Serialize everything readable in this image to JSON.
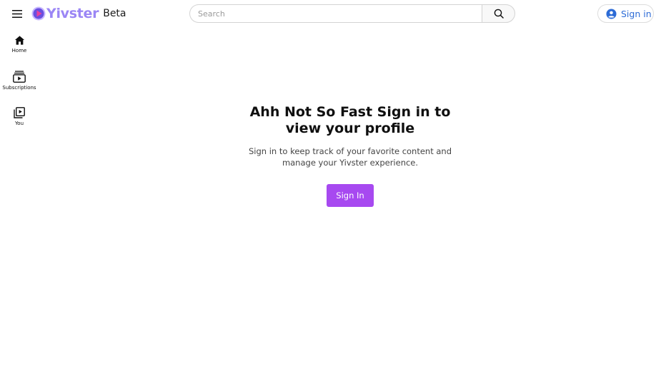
{
  "header": {
    "logo_text": "Yivster",
    "logo_badge": "Beta",
    "search_placeholder": "Search",
    "signin_label": "Sign in"
  },
  "sidebar": {
    "items": [
      {
        "label": "Home",
        "icon": "home-icon"
      },
      {
        "label": "Subscriptions",
        "icon": "subscriptions-icon"
      },
      {
        "label": "You",
        "icon": "library-icon"
      }
    ]
  },
  "main": {
    "headline": "Ahh Not So Fast Sign in to view your profile",
    "subtext": "Sign in to keep track of your favorite content and manage your Yivster experience.",
    "cta_label": "Sign In"
  },
  "colors": {
    "accent": "#a749f0",
    "logo": "#9b86f5",
    "link": "#2c6bd6"
  }
}
